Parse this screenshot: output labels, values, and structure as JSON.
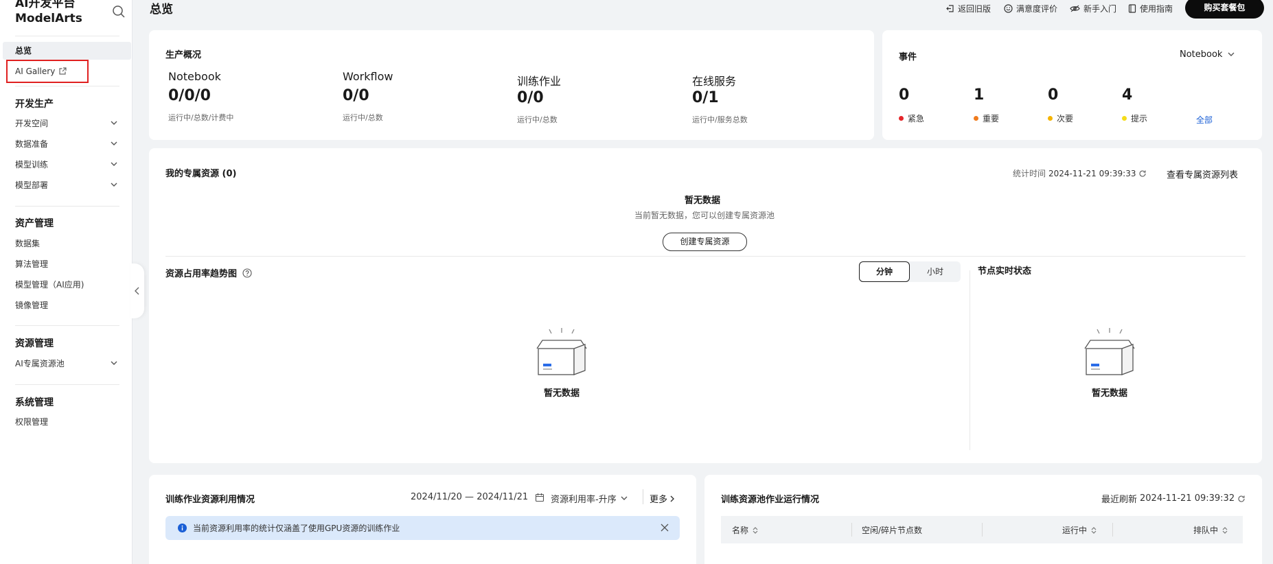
{
  "sidebar": {
    "brand_line1": "AI开发平台",
    "brand_line2": "ModelArts",
    "overview": "总览",
    "gallery": "AI Gallery",
    "groups": {
      "dev": "开发生产",
      "assets": "资产管理",
      "resources": "资源管理",
      "system": "系统管理"
    },
    "items": {
      "dev_space": "开发空间",
      "data_prep": "数据准备",
      "model_train": "模型训练",
      "model_deploy": "模型部署",
      "dataset": "数据集",
      "algo_mgmt": "算法管理",
      "model_mgmt": "模型管理（AI应用)",
      "image_mgmt": "镜像管理",
      "ai_pool": "AI专属资源池",
      "perm_mgmt": "权限管理"
    }
  },
  "header": {
    "title": "总览",
    "links": {
      "back_old": "返回旧版",
      "feedback": "满意度评价",
      "newbie": "新手入门",
      "guide": "使用指南"
    },
    "buy_button": "购买套餐包"
  },
  "production": {
    "title": "生产概况",
    "stats": [
      {
        "label": "Notebook",
        "value": "0/0/0",
        "sub": "运行中/总数/计费中"
      },
      {
        "label": "Workflow",
        "value": "0/0",
        "sub": "运行中/总数"
      },
      {
        "label": "训练作业",
        "value": "0/0",
        "sub": "运行中/总数"
      },
      {
        "label": "在线服务",
        "value": "0/1",
        "sub": "运行中/服务总数"
      }
    ]
  },
  "events": {
    "title": "事件",
    "selector": "Notebook",
    "items": [
      {
        "count": "0",
        "label": "紧急",
        "color": "#e5262a"
      },
      {
        "count": "1",
        "label": "重要",
        "color": "#f07b1d"
      },
      {
        "count": "0",
        "label": "次要",
        "color": "#f5b400"
      },
      {
        "count": "4",
        "label": "提示",
        "color": "#f5dc1a"
      }
    ],
    "all_link": "全部"
  },
  "dedicated": {
    "title": "我的专属资源 (0)",
    "stat_time_label": "统计时间",
    "stat_time": "2024-11-21 09:39:33",
    "view_list": "查看专属资源列表",
    "empty_title": "暂无数据",
    "empty_desc": "当前暂无数据，您可以创建专属资源池",
    "create_button": "创建专属资源"
  },
  "trend": {
    "title": "资源占用率趋势图",
    "seg_minute": "分钟",
    "seg_hour": "小时",
    "empty": "暂无数据"
  },
  "nodes": {
    "title": "节点实时状态",
    "empty": "暂无数据"
  },
  "train_usage": {
    "title": "训练作业资源利用情况",
    "date_range": "2024/11/20 — 2024/11/21",
    "sort": "资源利用率-升序",
    "more": "更多",
    "notice": "当前资源利用率的统计仅涵盖了使用GPU资源的训练作业"
  },
  "pool_jobs": {
    "title": "训练资源池作业运行情况",
    "refresh_label": "最近刷新",
    "refresh_time": "2024-11-21 09:39:32",
    "columns": [
      "名称",
      "空闲/碎片节点数",
      "运行中",
      "排队中"
    ]
  },
  "colors": {
    "accent_blue": "#1a5fd6",
    "highlight_red": "#e02020",
    "primary_black": "#0c0c0c"
  }
}
